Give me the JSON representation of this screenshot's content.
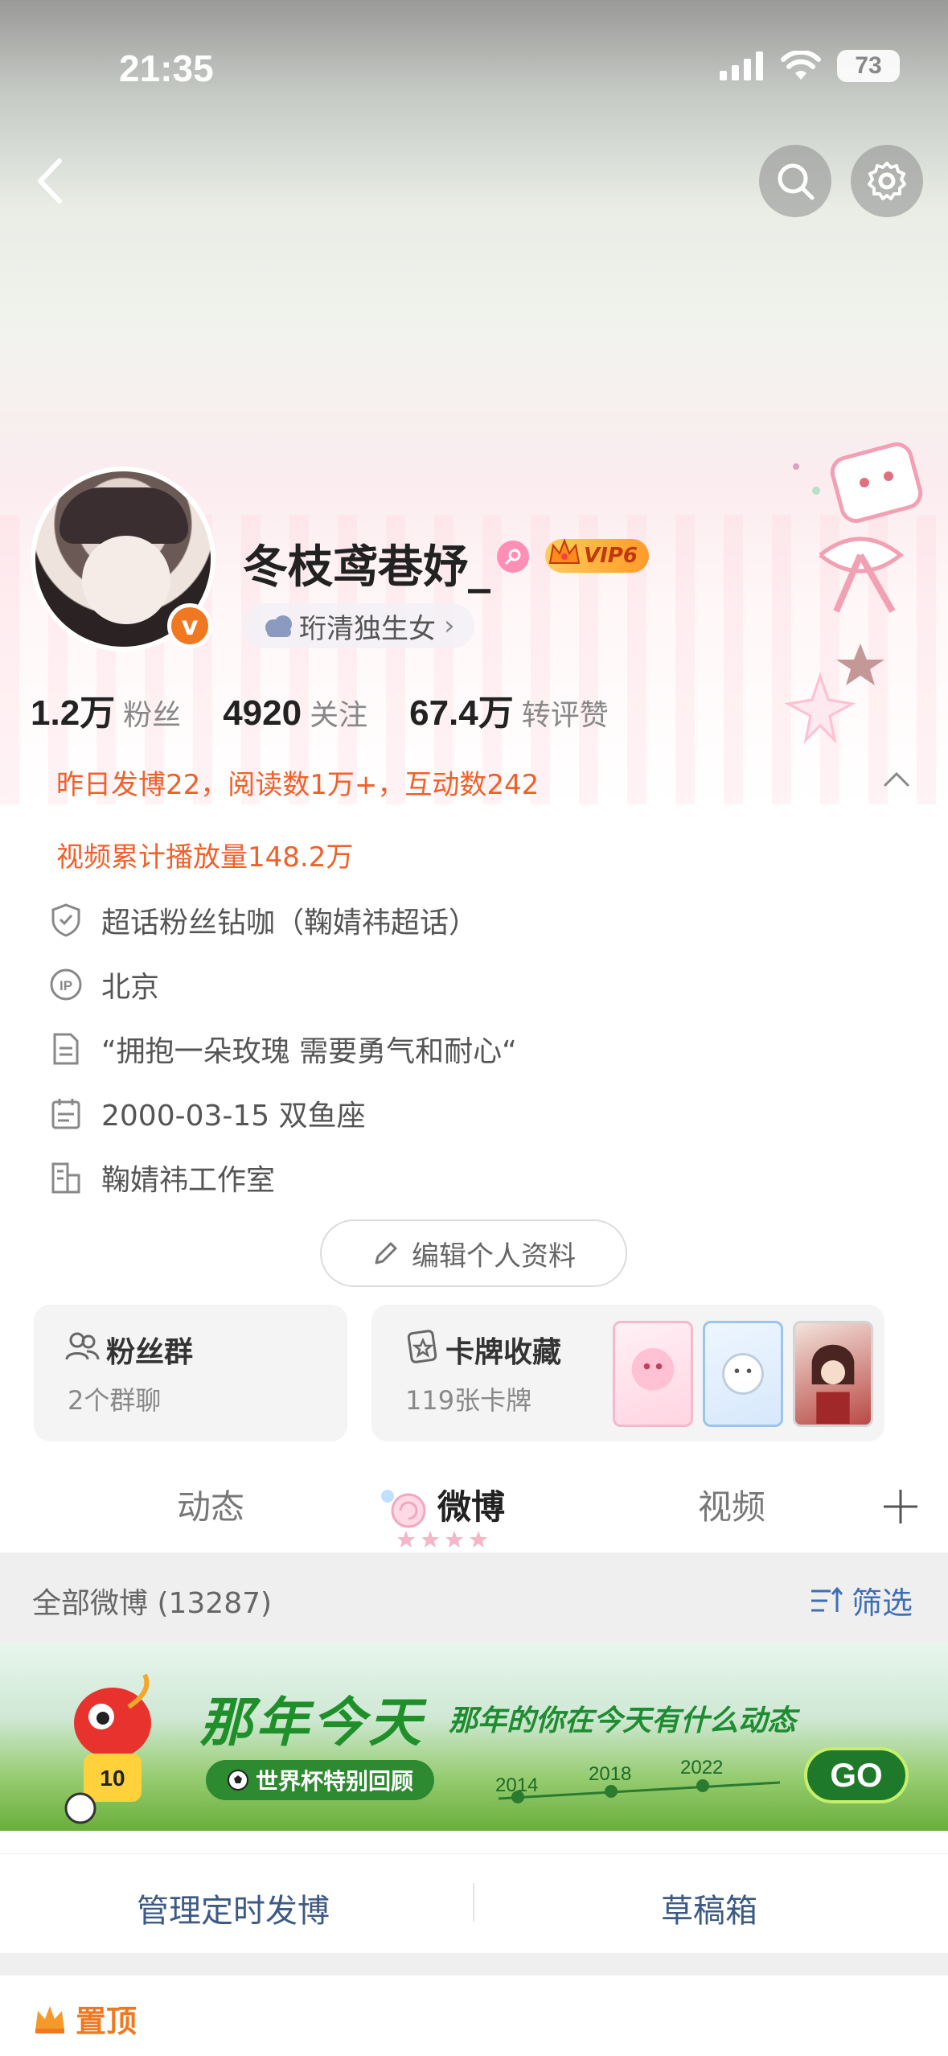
{
  "status_bar": {
    "time": "21:35",
    "battery": "73"
  },
  "profile": {
    "name": "冬枝鸢巷妤_",
    "vip": "VIP6",
    "tag": "珩清独生女",
    "stats": [
      {
        "value": "1.2万",
        "label": "粉丝"
      },
      {
        "value": "4920",
        "label": "关注"
      },
      {
        "value": "67.4万",
        "label": "转评赞"
      }
    ]
  },
  "summary": {
    "line1": "昨日发博22，阅读数1万+，互动数242",
    "line2": "视频累计播放量148.2万"
  },
  "info": {
    "supertopic": "超话粉丝钻咖（鞠婧祎超话）",
    "ip": "北京",
    "bio": "“拥抱一朵玫瑰 需要勇气和耐心“",
    "birthday": "2000-03-15 双鱼座",
    "company": "鞠婧祎工作室"
  },
  "edit_button": "编辑个人资料",
  "cards": {
    "fans": {
      "title": "粉丝群",
      "sub": "2个群聊"
    },
    "collect": {
      "title": "卡牌收藏",
      "sub": "119张卡牌"
    }
  },
  "tabs": [
    {
      "label": "动态"
    },
    {
      "label": "微博"
    },
    {
      "label": "视频"
    }
  ],
  "filter": {
    "all": "全部微博 (13287)",
    "filter_label": "筛选"
  },
  "banner": {
    "title": "那年今天",
    "subtitle": "那年的你在今天有什么动态",
    "pill": "世界杯特别回顾",
    "years": [
      "2014",
      "2018",
      "2022"
    ],
    "go": "GO"
  },
  "actions": {
    "scheduled": "管理定时发博",
    "drafts": "草稿箱"
  },
  "pinned": "置顶",
  "colors": {
    "accent_orange": "#f0602a",
    "link_blue": "#3e6fb5",
    "banner_green": "#1f8f2a"
  }
}
